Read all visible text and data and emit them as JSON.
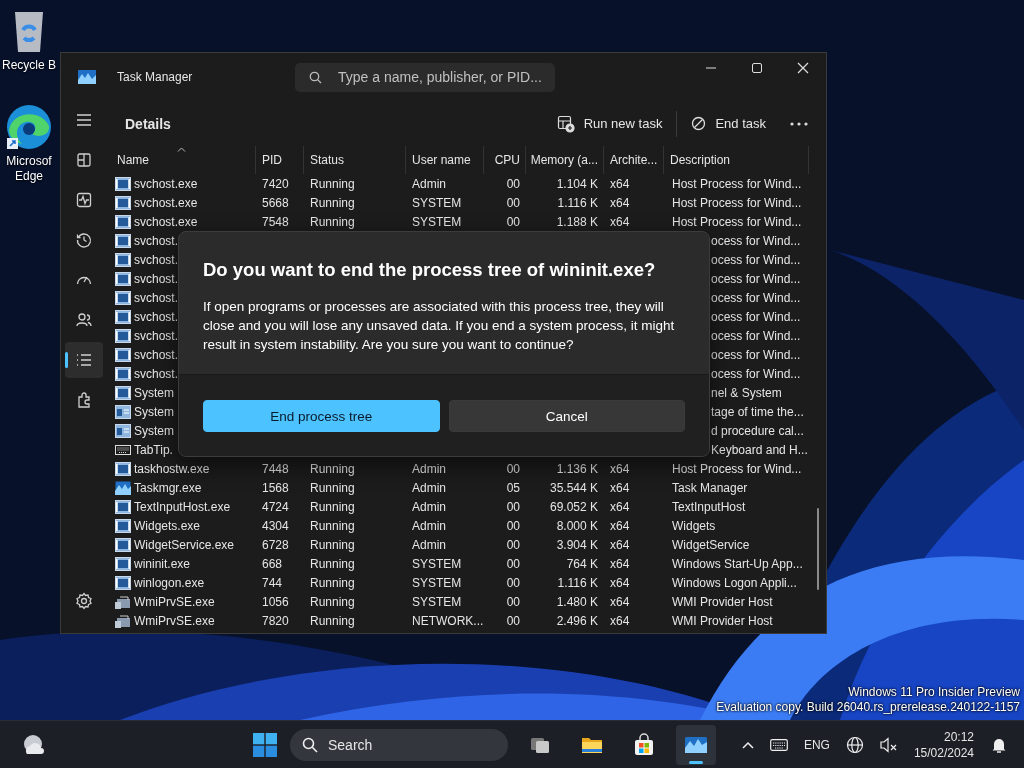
{
  "desktop_icons": [
    {
      "kind": "recycle",
      "label": "Recycle B"
    },
    {
      "kind": "edge",
      "label": "Microsof Edge"
    }
  ],
  "window": {
    "title": "Task Manager",
    "search": {
      "placeholder": "Type a name, publisher, or PID..."
    }
  },
  "sidebar": {
    "items": [
      {
        "kind": "menu",
        "selected": false
      },
      {
        "kind": "processes",
        "selected": false
      },
      {
        "kind": "performance",
        "selected": false
      },
      {
        "kind": "history",
        "selected": false
      },
      {
        "kind": "startup",
        "selected": false
      },
      {
        "kind": "users",
        "selected": false
      },
      {
        "kind": "details",
        "selected": true
      },
      {
        "kind": "services",
        "selected": false
      }
    ],
    "settings": {
      "kind": "settings",
      "selected": false
    }
  },
  "toolbar": {
    "title": "Details",
    "run_new_task": "Run new task",
    "end_task": "End task"
  },
  "table": {
    "columns": [
      "Name",
      "PID",
      "Status",
      "User name",
      "CPU",
      "Memory (a...",
      "Archite...",
      "Description"
    ],
    "rows": [
      {
        "kind": "app",
        "name": "svchost.exe",
        "pid": "7420",
        "status": "Running",
        "user": "Admin",
        "cpu": "00",
        "memory": "1.104 K",
        "arch": "x64",
        "description": "Host Process for Wind..."
      },
      {
        "kind": "app",
        "name": "svchost.exe",
        "pid": "5668",
        "status": "Running",
        "user": "SYSTEM",
        "cpu": "00",
        "memory": "1.116 K",
        "arch": "x64",
        "description": "Host Process for Wind..."
      },
      {
        "kind": "app",
        "name": "svchost.exe",
        "pid": "7548",
        "status": "Running",
        "user": "SYSTEM",
        "cpu": "00",
        "memory": "1.188 K",
        "arch": "x64",
        "description": "Host Process for Wind..."
      },
      {
        "kind": "app",
        "name": "svchost.",
        "description": "ocess for Wind..."
      },
      {
        "kind": "app",
        "name": "svchost.",
        "description": "ocess for Wind..."
      },
      {
        "kind": "app",
        "name": "svchost.",
        "description": "ocess for Wind..."
      },
      {
        "kind": "app",
        "name": "svchost.",
        "description": "ocess for Wind..."
      },
      {
        "kind": "app",
        "name": "svchost.",
        "description": "ocess for Wind..."
      },
      {
        "kind": "app",
        "name": "svchost.",
        "description": "ocess for Wind..."
      },
      {
        "kind": "app",
        "name": "svchost.",
        "description": "ocess for Wind..."
      },
      {
        "kind": "app",
        "name": "svchost.",
        "description": "ocess for Wind..."
      },
      {
        "kind": "app",
        "name": "System",
        "description": "nel & System"
      },
      {
        "kind": "window",
        "name": "System",
        "description": "tage of time the..."
      },
      {
        "kind": "window",
        "name": "System",
        "description": "d procedure cal..."
      },
      {
        "kind": "keyboard",
        "name": "TabTip.",
        "description": "Keyboard and H..."
      },
      {
        "kind": "app",
        "name": "taskhostw.exe",
        "pid": "7448",
        "status": "Running",
        "user": "Admin",
        "cpu": "00",
        "memory": "1.136 K",
        "arch": "x64",
        "description": "Host Process for Wind..."
      },
      {
        "kind": "taskmgr",
        "name": "Taskmgr.exe",
        "pid": "1568",
        "status": "Running",
        "user": "Admin",
        "cpu": "05",
        "memory": "35.544 K",
        "arch": "x64",
        "description": "Task Manager"
      },
      {
        "kind": "app",
        "name": "TextInputHost.exe",
        "pid": "4724",
        "status": "Running",
        "user": "Admin",
        "cpu": "00",
        "memory": "69.052 K",
        "arch": "x64",
        "description": "TextInputHost"
      },
      {
        "kind": "app",
        "name": "Widgets.exe",
        "pid": "4304",
        "status": "Running",
        "user": "Admin",
        "cpu": "00",
        "memory": "8.000 K",
        "arch": "x64",
        "description": "Widgets"
      },
      {
        "kind": "app",
        "name": "WidgetService.exe",
        "pid": "6728",
        "status": "Running",
        "user": "Admin",
        "cpu": "00",
        "memory": "3.904 K",
        "arch": "x64",
        "description": "WidgetService"
      },
      {
        "kind": "app",
        "name": "wininit.exe",
        "pid": "668",
        "status": "Running",
        "user": "SYSTEM",
        "cpu": "00",
        "memory": "764 K",
        "arch": "x64",
        "description": "Windows Start-Up App..."
      },
      {
        "kind": "app",
        "name": "winlogon.exe",
        "pid": "744",
        "status": "Running",
        "user": "SYSTEM",
        "cpu": "00",
        "memory": "1.116 K",
        "arch": "x64",
        "description": "Windows Logon Appli..."
      },
      {
        "kind": "wmi",
        "name": "WmiPrvSE.exe",
        "pid": "1056",
        "status": "Running",
        "user": "SYSTEM",
        "cpu": "00",
        "memory": "1.480 K",
        "arch": "x64",
        "description": "WMI Provider Host"
      },
      {
        "kind": "wmi",
        "name": "WmiPrvSE.exe",
        "pid": "7820",
        "status": "Running",
        "user": "NETWORK...",
        "cpu": "00",
        "memory": "2.496 K",
        "arch": "x64",
        "description": "WMI Provider Host"
      }
    ]
  },
  "dialog": {
    "title": "Do you want to end the process tree of wininit.exe?",
    "message": "If open programs or processes are associated with this process tree, they will close and you will lose any unsaved data. If you end a system process, it might result in system instability. Are you sure you want to continue?",
    "primary_button": "End process tree",
    "secondary_button": "Cancel"
  },
  "watermark": [
    "Windows 11 Pro Insider Preview",
    "Evaluation copy. Build 26040.rs_prerelease.240122-1157"
  ],
  "taskbar": {
    "search": "Search",
    "apps": [
      {
        "kind": "taskview",
        "active": false
      },
      {
        "kind": "explorer",
        "active": false
      },
      {
        "kind": "store",
        "active": false
      },
      {
        "kind": "taskmgr",
        "active": true
      }
    ],
    "language": "ENG",
    "time": "20:12",
    "date": "15/02/2024"
  }
}
